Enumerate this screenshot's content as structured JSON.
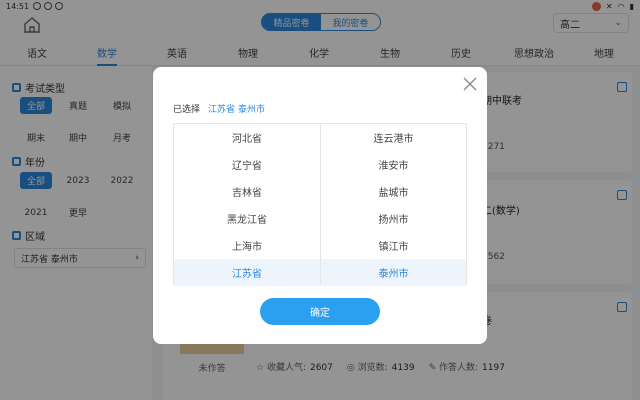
{
  "status": {
    "time": "14:51"
  },
  "header": {
    "segments": [
      "精品密卷",
      "我的密卷"
    ],
    "grade": "高二"
  },
  "subjects": [
    "语文",
    "数学",
    "英语",
    "物理",
    "化学",
    "生物",
    "历史",
    "思想政治",
    "地理"
  ],
  "filters": {
    "exam_type_label": "考试类型",
    "exam_types": [
      "全部",
      "真题",
      "模拟",
      "期末",
      "期中",
      "月考"
    ],
    "year_label": "年份",
    "years": [
      "全部",
      "2023",
      "2022",
      "2021",
      "更早"
    ],
    "region_label": "区域",
    "region_value": "江苏省 泰州市"
  },
  "cards": [
    {
      "title_tail": "期中联考",
      "count": "1271"
    },
    {
      "title_tail": "二(数学)",
      "count": "1562"
    },
    {
      "title_tail": "卷"
    }
  ],
  "bottom_card": {
    "status": "未作答",
    "fav_label": "收藏人气:",
    "fav_value": "2607",
    "view_label": "浏览数:",
    "view_value": "4139",
    "answer_label": "作答人数:",
    "answer_value": "1197"
  },
  "dialog": {
    "selected_label": "已选择",
    "selected_province": "江苏省",
    "selected_city": "泰州市",
    "provinces": [
      "河北省",
      "辽宁省",
      "吉林省",
      "黑龙江省",
      "上海市",
      "江苏省"
    ],
    "cities": [
      "连云港市",
      "淮安市",
      "盐城市",
      "扬州市",
      "镇江市",
      "泰州市"
    ],
    "confirm": "确定"
  },
  "colors": {
    "accent": "#2b87de",
    "button": "#2b9ff0"
  }
}
